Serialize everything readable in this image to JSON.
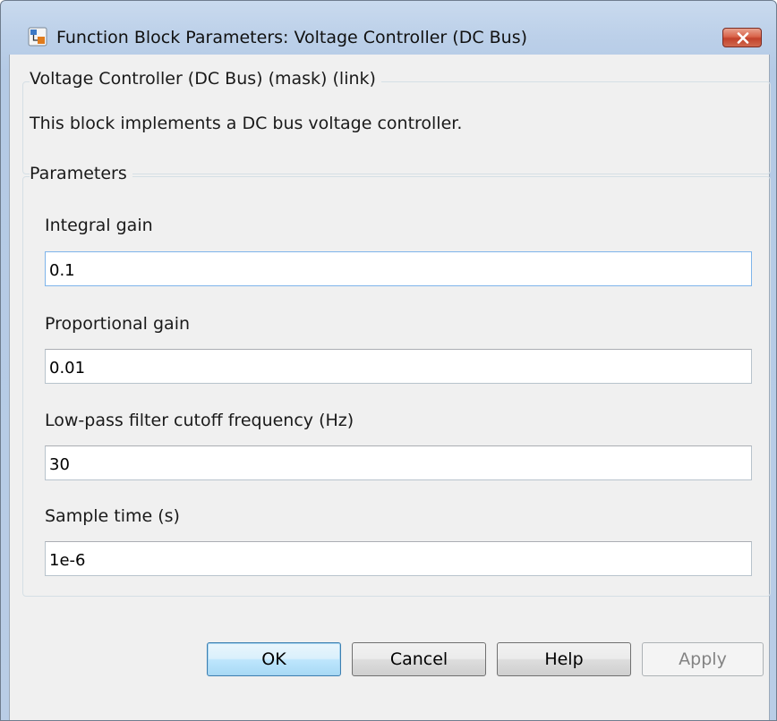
{
  "window": {
    "title": "Function Block Parameters: Voltage Controller (DC Bus)",
    "close_icon": "close-x"
  },
  "description_group": {
    "legend": "Voltage Controller (DC Bus) (mask) (link)",
    "text": "This block implements a DC bus voltage controller."
  },
  "parameters_group": {
    "legend": "Parameters",
    "fields": [
      {
        "label": "Integral gain",
        "value": "0.1"
      },
      {
        "label": "Proportional gain",
        "value": "0.01"
      },
      {
        "label": "Low-pass filter cutoff frequency (Hz)",
        "value": "30"
      },
      {
        "label": "Sample time (s)",
        "value": "1e-6"
      }
    ]
  },
  "buttons": {
    "ok": "OK",
    "cancel": "Cancel",
    "help": "Help",
    "apply": "Apply"
  },
  "colors": {
    "title_bar": "#b9cde6",
    "dialog_bg": "#f0f0f0",
    "close_button": "#c94a33",
    "focus_border": "#7eb4ea",
    "default_button_border": "#3c7fb1"
  }
}
